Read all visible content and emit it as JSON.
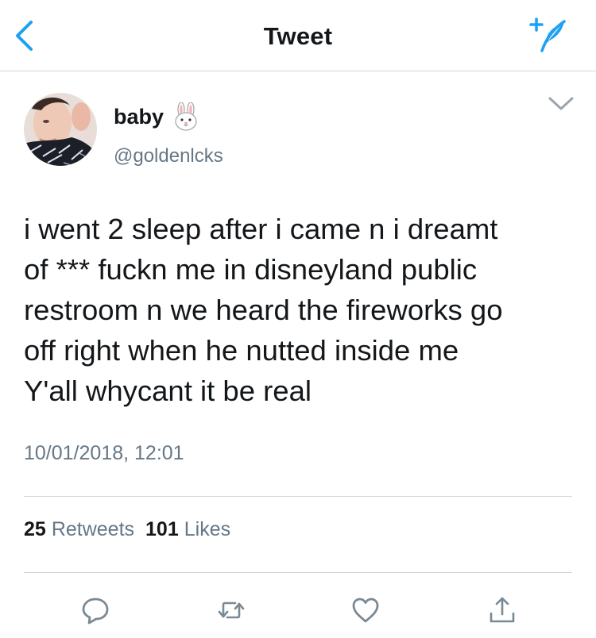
{
  "navbar": {
    "title": "Tweet",
    "back_icon": "chevron-left-icon",
    "compose_icon": "compose-tweet-feather-icon"
  },
  "tweet": {
    "display_name": "baby",
    "display_name_emoji": "🐰",
    "handle": "@goldenlcks",
    "text_lines": [
      "i went 2 sleep after i came n i dreamt",
      "of *** fuckn me in disneyland public",
      "restroom n we heard the fireworks go",
      "off right when he nutted inside me",
      "Y'all whycant it be real"
    ],
    "timestamp": "10/01/2018, 12:01",
    "stats": {
      "retweets_count": "25",
      "retweets_label": "Retweets",
      "likes_count": "101",
      "likes_label": "Likes"
    }
  },
  "actions": [
    "reply-icon",
    "retweet-icon",
    "like-icon",
    "share-icon"
  ],
  "colors": {
    "accent": "#1da1f2",
    "text": "#14171a",
    "secondary_text": "#657786",
    "icon_gray": "#7a8994",
    "divider": "#cfd4d9"
  }
}
